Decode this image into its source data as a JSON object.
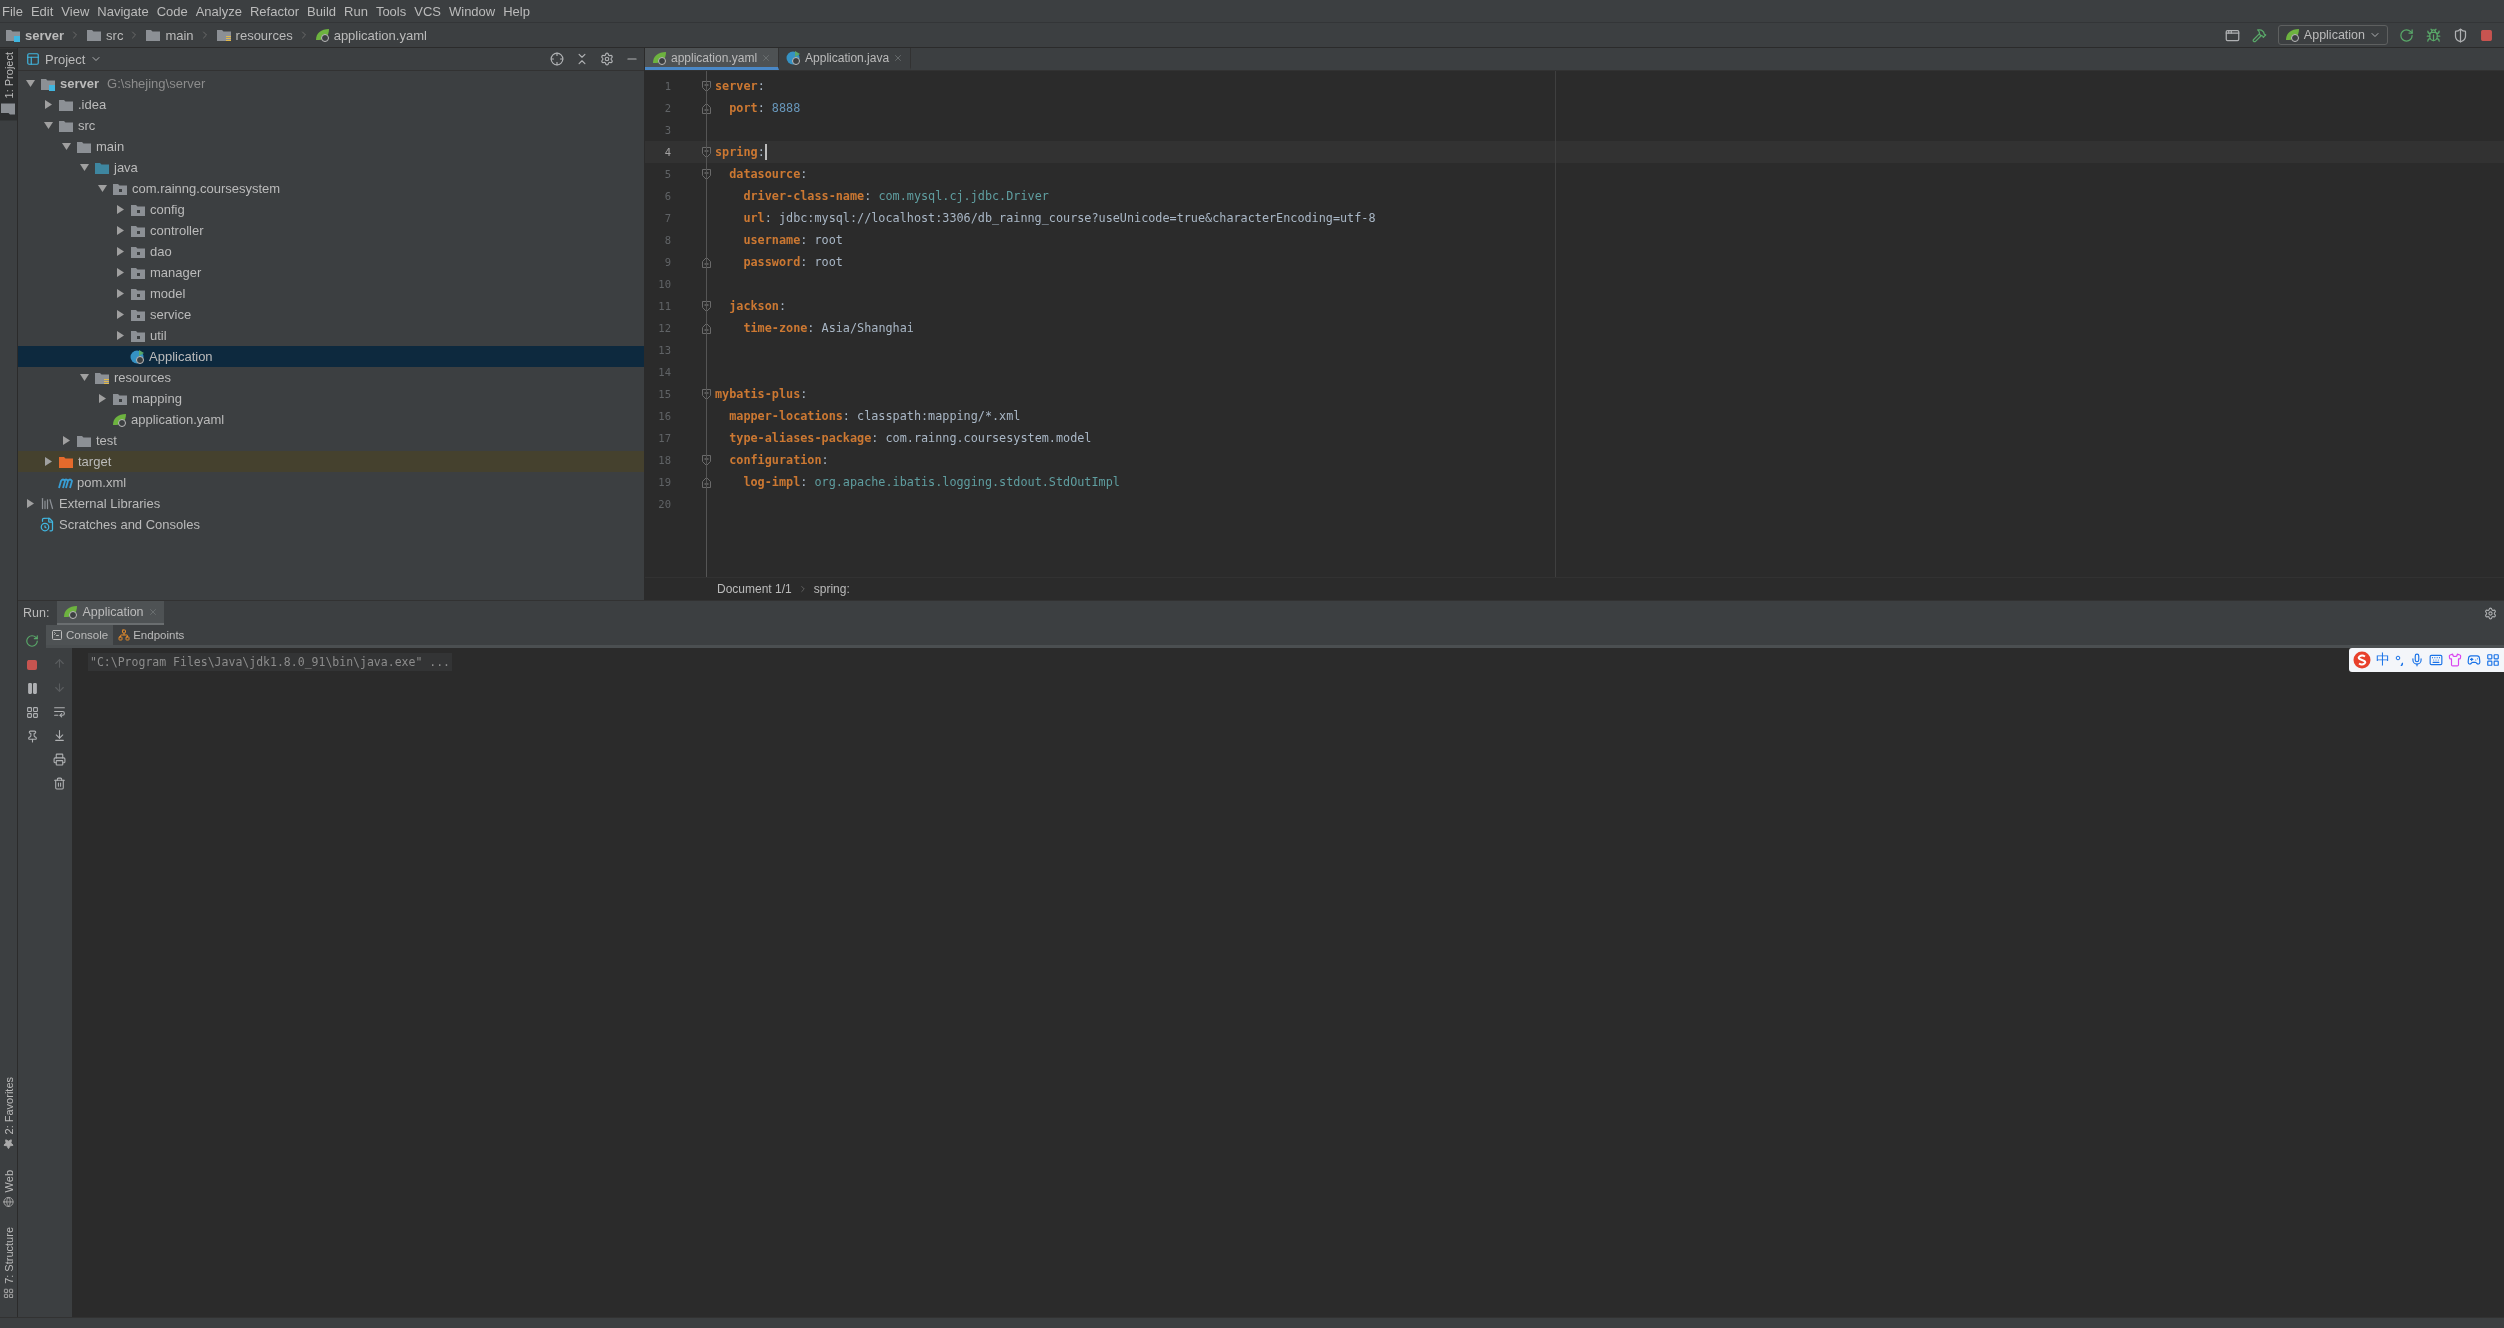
{
  "menu": [
    "File",
    "Edit",
    "View",
    "Navigate",
    "Code",
    "Analyze",
    "Refactor",
    "Build",
    "Run",
    "Tools",
    "VCS",
    "Window",
    "Help"
  ],
  "breadcrumbs": [
    {
      "label": "server",
      "kind": "module"
    },
    {
      "label": "src",
      "kind": "folder"
    },
    {
      "label": "main",
      "kind": "folder"
    },
    {
      "label": "resources",
      "kind": "resources"
    },
    {
      "label": "application.yaml",
      "kind": "spring"
    }
  ],
  "run_config": {
    "label": "Application"
  },
  "side_tabs_top": [
    {
      "label": "1: Project",
      "kind": "project",
      "selected": true
    }
  ],
  "side_tabs_bottom": [
    {
      "label": "2: Favorites",
      "kind": "favorites",
      "selected": false
    },
    {
      "label": "Web",
      "kind": "web",
      "selected": false
    },
    {
      "label": "7: Structure",
      "kind": "structure",
      "selected": false
    }
  ],
  "project_panel": {
    "title": "Project",
    "tree": [
      {
        "label": "server",
        "hint": "G:\\shejing\\server",
        "kind": "module",
        "expanded": true,
        "selected": false,
        "children": [
          {
            "label": ".idea",
            "kind": "folder",
            "expanded": false,
            "selected": false
          },
          {
            "label": "src",
            "kind": "folder",
            "expanded": true,
            "selected": false,
            "children": [
              {
                "label": "main",
                "kind": "folder",
                "expanded": true,
                "selected": false,
                "children": [
                  {
                    "label": "java",
                    "kind": "source",
                    "expanded": true,
                    "selected": false,
                    "children": [
                      {
                        "label": "com.rainng.coursesystem",
                        "kind": "package",
                        "expanded": true,
                        "selected": false,
                        "children": [
                          {
                            "label": "config",
                            "kind": "package",
                            "expanded": false,
                            "selected": false
                          },
                          {
                            "label": "controller",
                            "kind": "package",
                            "expanded": false,
                            "selected": false
                          },
                          {
                            "label": "dao",
                            "kind": "package",
                            "expanded": false,
                            "selected": false
                          },
                          {
                            "label": "manager",
                            "kind": "package",
                            "expanded": false,
                            "selected": false
                          },
                          {
                            "label": "model",
                            "kind": "package",
                            "expanded": false,
                            "selected": false
                          },
                          {
                            "label": "service",
                            "kind": "package",
                            "expanded": false,
                            "selected": false
                          },
                          {
                            "label": "util",
                            "kind": "package",
                            "expanded": false,
                            "selected": false
                          },
                          {
                            "label": "Application",
                            "kind": "class",
                            "selected": true
                          }
                        ]
                      }
                    ]
                  },
                  {
                    "label": "resources",
                    "kind": "resources",
                    "expanded": true,
                    "selected": false,
                    "children": [
                      {
                        "label": "mapping",
                        "kind": "package",
                        "expanded": false,
                        "selected": false
                      },
                      {
                        "label": "application.yaml",
                        "kind": "spring",
                        "selected": false
                      }
                    ]
                  }
                ]
              },
              {
                "label": "test",
                "kind": "folder",
                "expanded": false,
                "selected": false
              }
            ]
          },
          {
            "label": "target",
            "kind": "excluded",
            "expanded": false,
            "selected": false
          },
          {
            "label": "pom.xml",
            "kind": "maven",
            "selected": false
          }
        ]
      },
      {
        "label": "External Libraries",
        "kind": "libraries",
        "expanded": false,
        "selected": false
      },
      {
        "label": "Scratches and Consoles",
        "kind": "scratches",
        "selected": false
      }
    ]
  },
  "editor": {
    "tabs": [
      {
        "label": "application.yaml",
        "kind": "spring",
        "selected": true
      },
      {
        "label": "Application.java",
        "kind": "class",
        "selected": false
      }
    ],
    "lines": [
      {
        "number": "1",
        "current": false,
        "kind": "fold-start",
        "tokens": [
          {
            "text": "server",
            "kind": "key"
          },
          {
            "text": ":",
            "kind": "punct"
          }
        ]
      },
      {
        "number": "2",
        "current": false,
        "kind": "fold-end",
        "tokens": [
          {
            "text": "  port",
            "kind": "key"
          },
          {
            "text": ": ",
            "kind": "punct"
          },
          {
            "text": "8888",
            "kind": "number"
          }
        ]
      },
      {
        "number": "3",
        "current": false
      },
      {
        "number": "4",
        "current": true,
        "kind": "fold-start",
        "tokens": [
          {
            "text": "spring",
            "kind": "key"
          },
          {
            "text": ":",
            "kind": "punct"
          }
        ]
      },
      {
        "number": "5",
        "current": false,
        "kind": "fold-start",
        "tokens": [
          {
            "text": "  datasource",
            "kind": "key"
          },
          {
            "text": ":",
            "kind": "punct"
          }
        ]
      },
      {
        "number": "6",
        "current": false,
        "tokens": [
          {
            "text": "    driver-class-name",
            "kind": "key"
          },
          {
            "text": ": ",
            "kind": "punct"
          },
          {
            "text": "com.mysql.cj.jdbc.Driver",
            "kind": "ref"
          }
        ]
      },
      {
        "number": "7",
        "current": false,
        "tokens": [
          {
            "text": "    url",
            "kind": "key"
          },
          {
            "text": ": ",
            "kind": "punct"
          },
          {
            "text": "jdbc:mysql://localhost:3306/db_rainng_course?useUnicode=true&characterEncoding=utf-8",
            "kind": "plain"
          }
        ]
      },
      {
        "number": "8",
        "current": false,
        "tokens": [
          {
            "text": "    username",
            "kind": "key"
          },
          {
            "text": ": ",
            "kind": "punct"
          },
          {
            "text": "root",
            "kind": "plain"
          }
        ]
      },
      {
        "number": "9",
        "current": false,
        "kind": "fold-end",
        "tokens": [
          {
            "text": "    password",
            "kind": "key"
          },
          {
            "text": ": ",
            "kind": "punct"
          },
          {
            "text": "root",
            "kind": "plain"
          }
        ]
      },
      {
        "number": "10",
        "current": false
      },
      {
        "number": "11",
        "current": false,
        "kind": "fold-start",
        "tokens": [
          {
            "text": "  jackson",
            "kind": "key"
          },
          {
            "text": ":",
            "kind": "punct"
          }
        ]
      },
      {
        "number": "12",
        "current": false,
        "kind": "fold-end",
        "tokens": [
          {
            "text": "    time-zone",
            "kind": "key"
          },
          {
            "text": ": ",
            "kind": "punct"
          },
          {
            "text": "Asia/Shanghai",
            "kind": "plain"
          }
        ]
      },
      {
        "number": "13",
        "current": false
      },
      {
        "number": "14",
        "current": false
      },
      {
        "number": "15",
        "current": false,
        "kind": "fold-start",
        "tokens": [
          {
            "text": "mybatis-plus",
            "kind": "key"
          },
          {
            "text": ":",
            "kind": "punct"
          }
        ]
      },
      {
        "number": "16",
        "current": false,
        "tokens": [
          {
            "text": "  mapper-locations",
            "kind": "key"
          },
          {
            "text": ": ",
            "kind": "punct"
          },
          {
            "text": "classpath:mapping/*.xml",
            "kind": "plain"
          }
        ]
      },
      {
        "number": "17",
        "current": false,
        "tokens": [
          {
            "text": "  type-aliases-package",
            "kind": "key"
          },
          {
            "text": ": ",
            "kind": "punct"
          },
          {
            "text": "com.rainng.coursesystem.model",
            "kind": "plain"
          }
        ]
      },
      {
        "number": "18",
        "current": false,
        "kind": "fold-start",
        "tokens": [
          {
            "text": "  configuration",
            "kind": "key"
          },
          {
            "text": ":",
            "kind": "punct"
          }
        ]
      },
      {
        "number": "19",
        "current": false,
        "kind": "fold-end",
        "tokens": [
          {
            "text": "    log-impl",
            "kind": "key"
          },
          {
            "text": ": ",
            "kind": "punct"
          },
          {
            "text": "org.apache.ibatis.logging.stdout.StdOutImpl",
            "kind": "ref"
          }
        ]
      },
      {
        "number": "20",
        "current": false
      }
    ],
    "breadcrumb": [
      "Document 1/1",
      "spring:"
    ]
  },
  "run_panel": {
    "label": "Run:",
    "tabs": [
      {
        "label": "Application",
        "selected": true
      }
    ],
    "subtabs": [
      {
        "label": "Console",
        "kind": "console",
        "selected": true
      },
      {
        "label": "Endpoints",
        "kind": "endpoints",
        "selected": false
      }
    ],
    "console_lines": [
      "\"C:\\Program Files\\Java\\jdk1.8.0_91\\bin\\java.exe\" ..."
    ]
  },
  "ime": {
    "mode": "中"
  }
}
